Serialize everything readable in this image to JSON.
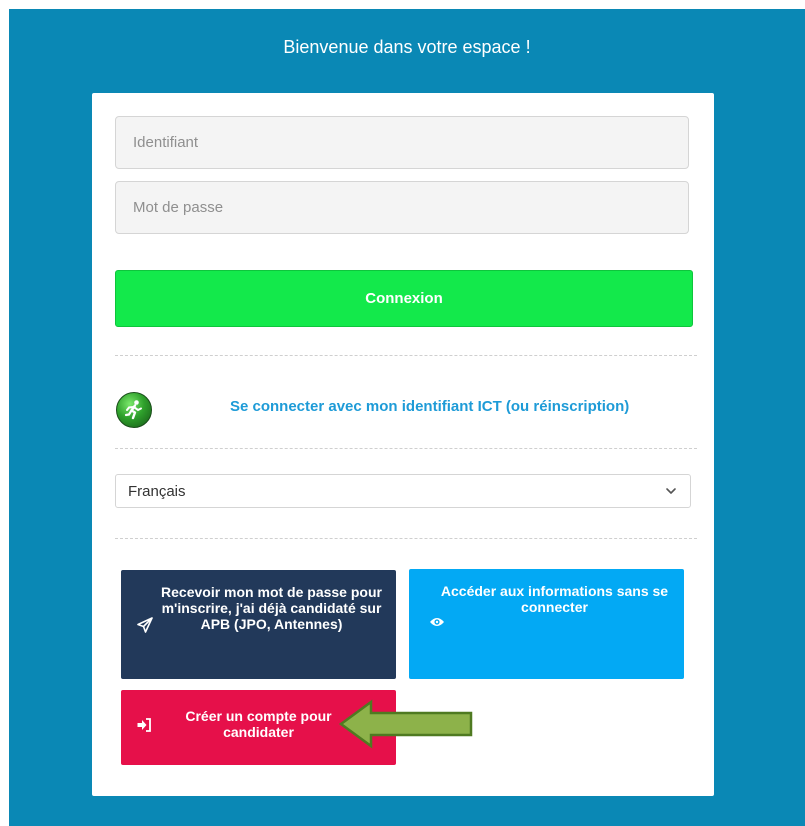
{
  "header": {
    "welcome": "Bienvenue dans votre espace !"
  },
  "login_form": {
    "identifiant_placeholder": "Identifiant",
    "password_placeholder": "Mot de passe",
    "connexion_label": "Connexion"
  },
  "ict": {
    "icon": "runner-icon",
    "link_label": "Se connecter avec mon identifiant ICT (ou réinscription)"
  },
  "language": {
    "selected": "Français",
    "icon": "chevron-down-icon"
  },
  "actions": {
    "receive_password": {
      "label": "Recevoir mon mot de passe pour m'inscrire, j'ai déjà candidaté sur APB (JPO, Antennes)",
      "icon": "paper-plane-icon",
      "color": "#22395a"
    },
    "access_info": {
      "label": "Accéder aux informations sans se connecter",
      "icon": "eye-icon",
      "color": "#03a9f4"
    },
    "create_account": {
      "label": "Créer un compte pour candidater",
      "icon": "sign-in-icon",
      "color": "#e6104a"
    }
  },
  "annotation": {
    "icon": "arrow-left-icon",
    "color": "#8db24a"
  },
  "colors": {
    "background": "#0a88b5",
    "connexion_button": "#13e94b",
    "link": "#1e9bd7"
  }
}
